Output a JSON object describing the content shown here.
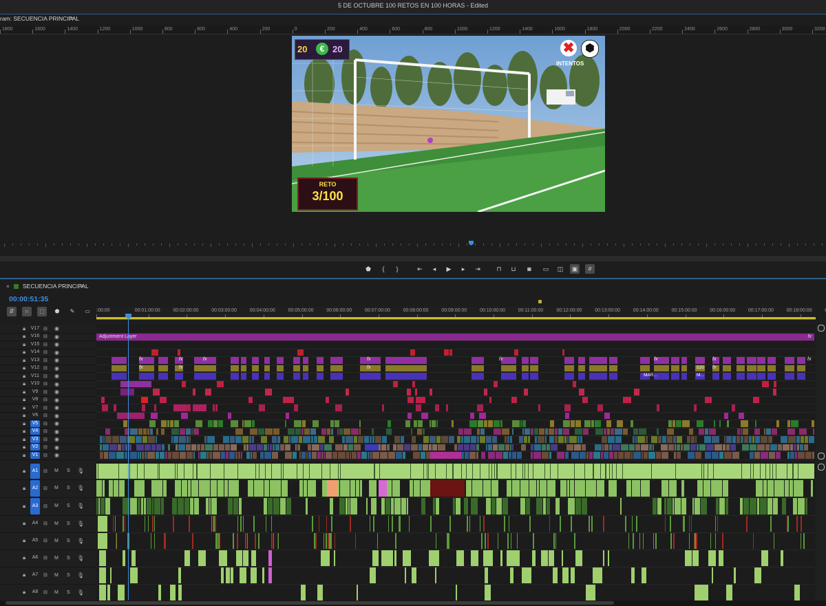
{
  "window": {
    "title": "5 DE OCTUBRE 100 RETOS EN 100 HORAS - Edited"
  },
  "program_monitor": {
    "tab_label": "ram: SECUENCIA PRINCIPAL",
    "tab_menu": "≡",
    "ruler": [
      "1800",
      "1600",
      "1400",
      "1200",
      "1000",
      "800",
      "600",
      "400",
      "200",
      "0",
      "200",
      "400",
      "600",
      "800",
      "1000",
      "1200",
      "1400",
      "1600",
      "1800",
      "2000",
      "2200",
      "2400",
      "2600",
      "2800",
      "3000",
      "3200"
    ],
    "overlay": {
      "coins_left": "20",
      "currency": "€",
      "coins_right": "20",
      "intentos": "INTENTOS",
      "reto_label": "RETO",
      "reto_value": "3/100"
    }
  },
  "transport": {
    "buttons": [
      "marker-icon",
      "in-point-icon",
      "out-point-icon",
      "go-to-in-icon",
      "step-back-icon",
      "play-icon",
      "step-forward-icon",
      "go-to-out-icon",
      "lift-icon",
      "extract-icon",
      "camera-icon",
      "safe-margins-icon",
      "comparison-icon",
      "proxy-icon",
      "settings-grid-icon"
    ]
  },
  "timeline": {
    "tab_close": "×",
    "tab_label": "SECUENCIA PRINCIPAL",
    "tab_menu": "≡",
    "timecode": "00:00:51:35",
    "ruler": [
      ":00:00",
      "00:01:00:00",
      "00:02:00:00",
      "00:03:00:00",
      "00:04:00:00",
      "00:05:00:00",
      "00:06:00:00",
      "00:07:00:00",
      "00:08:00:00",
      "00:09:00:00",
      "00:10:00:00",
      "00:11:00:00",
      "00:12:00:00",
      "00:13:00:00",
      "00:14:00:00",
      "00:15:00:00",
      "00:16:00:00",
      "00:17:00:00",
      "00:18:00:00",
      "00"
    ],
    "video_tracks": [
      "V17",
      "V16",
      "V15",
      "V14",
      "V13",
      "V12",
      "V11",
      "V10",
      "V9",
      "V8",
      "V7",
      "V6",
      "V5",
      "V4",
      "V3",
      "V2",
      "V1"
    ],
    "active_video": [
      "V5",
      "V4",
      "V3",
      "V2",
      "V1"
    ],
    "audio_tracks": [
      "A1",
      "A2",
      "A3",
      "A4",
      "A5",
      "A6",
      "A7",
      "A8"
    ],
    "active_audio": [
      "A1",
      "A2",
      "A3"
    ],
    "audio_m": "M",
    "audio_s": "S",
    "adjustment_layer": "Adjustment Layer",
    "fx": "fx",
    "clip_labels": {
      "mar": "MAR...",
      "m": "M...",
      "n520": "520"
    }
  },
  "colors": {
    "accent": "#2e5f8d",
    "playhead": "#3a8de0",
    "adjustment": "#8a2a90",
    "audio_clip": "#9fcf6e"
  }
}
